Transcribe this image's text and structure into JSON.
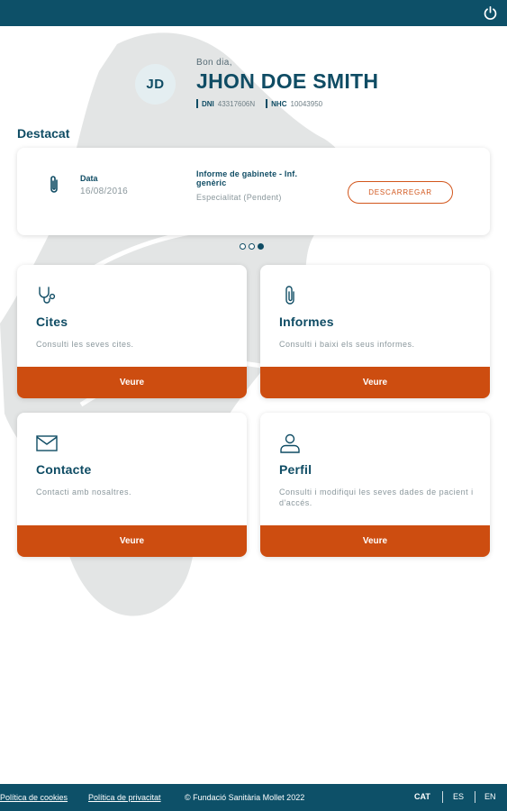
{
  "header": {
    "greeting": "Bon dia,",
    "user_name": "JHON DOE SMITH",
    "initials": "JD",
    "dni_label": "DNI",
    "dni_value": "43317606N",
    "nhc_label": "NHC",
    "nhc_value": "10043950"
  },
  "featured": {
    "section_title": "Destacat",
    "date_label": "Data",
    "date_value": "16/08/2016",
    "report_title": "Informe de gabinete - Inf. genèric",
    "report_subtitle": "Especialitat (Pendent)",
    "download_label": "DESCARREGAR",
    "carousel_count": 3,
    "carousel_active": 3
  },
  "cards": [
    {
      "title": "Cites",
      "description": "Consulti les seves cites.",
      "button": "Veure",
      "icon": "stethoscope-icon"
    },
    {
      "title": "Informes",
      "description": "Consulti i baixi els seus informes.",
      "button": "Veure",
      "icon": "paperclip-icon"
    },
    {
      "title": "Contacte",
      "description": "Contacti amb nosaltres.",
      "button": "Veure",
      "icon": "mail-icon"
    },
    {
      "title": "Perfil",
      "description": "Consulti i modifiqui les seves dades de pacient i d'accés.",
      "button": "Veure",
      "icon": "user-icon"
    }
  ],
  "footer": {
    "cookies_link": "Política de cookies",
    "privacy_link": "Política de privacitat",
    "copyright": "© Fundació Sanitària Mollet 2022",
    "languages": [
      "CAT",
      "ES",
      "EN"
    ],
    "active_language": "CAT"
  },
  "colors": {
    "primary": "#0d5068",
    "accent": "#cd4d10",
    "background_shape": "#e3e5e5"
  }
}
